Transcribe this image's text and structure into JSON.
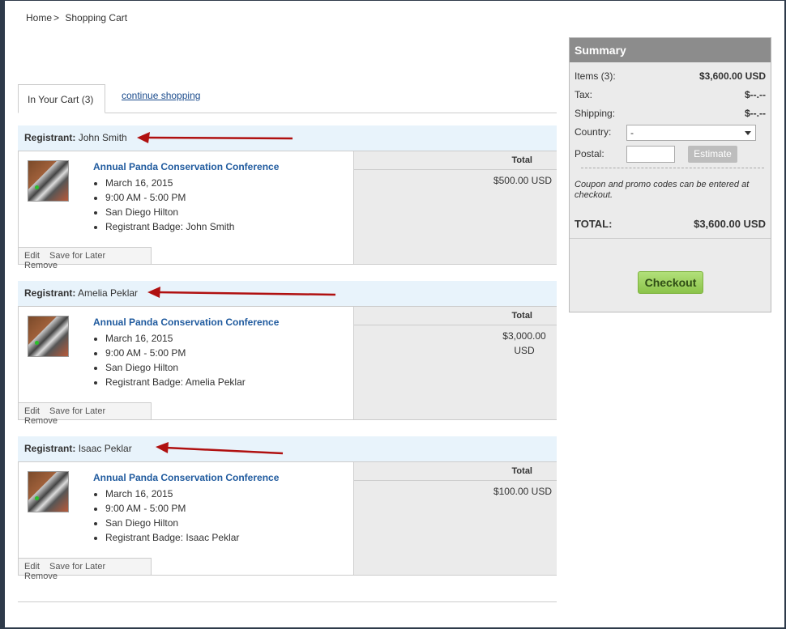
{
  "breadcrumb": {
    "home": "Home",
    "separator": ">",
    "current": "Shopping Cart"
  },
  "tabs": {
    "in_cart": "In Your Cart (3)",
    "continue": "continue shopping"
  },
  "cart_items": [
    {
      "registrant_label": "Registrant:",
      "registrant_name": "John Smith",
      "event_title": "Annual Panda Conservation Conference",
      "details": [
        "March 16, 2015",
        "9:00 AM - 5:00 PM",
        "San Diego Hilton",
        "Registrant Badge: John Smith"
      ],
      "total_header": "Total",
      "total": "$500.00 USD",
      "actions": {
        "edit": "Edit",
        "save": "Save for Later",
        "remove": "Remove"
      }
    },
    {
      "registrant_label": "Registrant:",
      "registrant_name": "Amelia Peklar",
      "event_title": "Annual Panda Conservation Conference",
      "details": [
        "March 16, 2015",
        "9:00 AM - 5:00 PM",
        "San Diego Hilton",
        "Registrant Badge: Amelia Peklar"
      ],
      "total_header": "Total",
      "total_line1": "$3,000.00",
      "total_line2": "USD",
      "actions": {
        "edit": "Edit",
        "save": "Save for Later",
        "remove": "Remove"
      }
    },
    {
      "registrant_label": "Registrant:",
      "registrant_name": "Isaac Peklar",
      "event_title": "Annual Panda Conservation Conference",
      "details": [
        "March 16, 2015",
        "9:00 AM - 5:00 PM",
        "San Diego Hilton",
        "Registrant Badge: Isaac Peklar"
      ],
      "total_header": "Total",
      "total": "$100.00 USD",
      "actions": {
        "edit": "Edit",
        "save": "Save for Later",
        "remove": "Remove"
      }
    }
  ],
  "summary": {
    "title": "Summary",
    "items_label": "Items (3):",
    "items_value": "$3,600.00 USD",
    "tax_label": "Tax:",
    "tax_value": "$--.--",
    "shipping_label": "Shipping:",
    "shipping_value": "$--.--",
    "country_label": "Country:",
    "country_value": "-",
    "postal_label": "Postal:",
    "estimate_label": "Estimate",
    "coupon_note": "Coupon and promo codes can be entered at checkout.",
    "total_label": "TOTAL:",
    "total_value": "$3,600.00 USD",
    "checkout_label": "Checkout"
  },
  "colors": {
    "annotation_arrow": "#b01010",
    "link": "#1f5a9e",
    "checkout": "#8bc34a",
    "summary_header": "#8c8c8c"
  }
}
